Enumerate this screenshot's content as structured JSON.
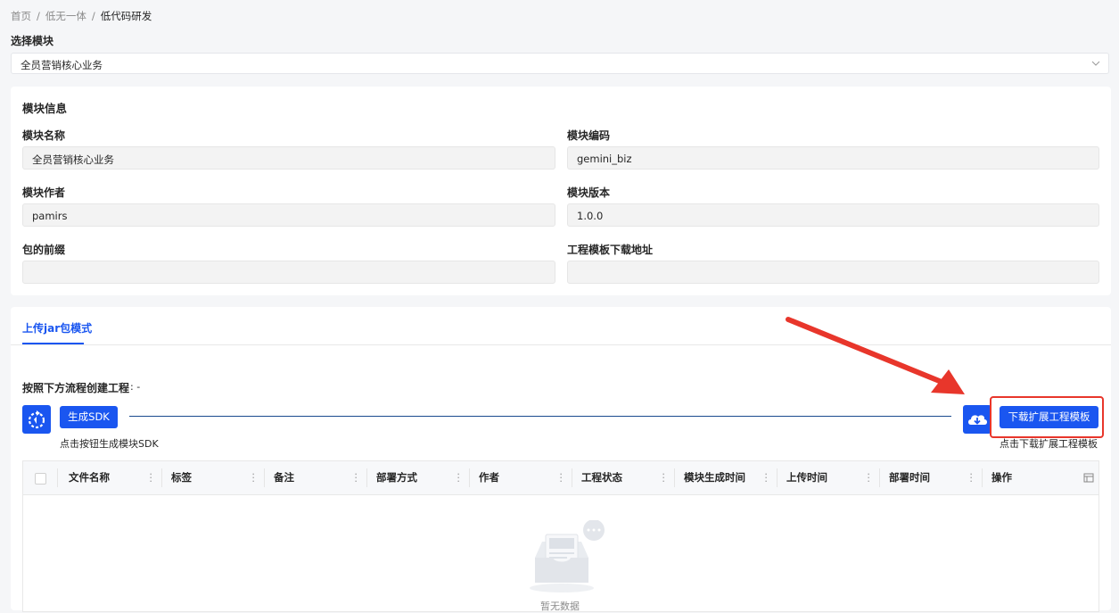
{
  "breadcrumb": {
    "home": "首页",
    "parent": "低无一体",
    "current": "低代码研发",
    "sep": "/"
  },
  "module_select": {
    "label": "选择模块",
    "value": "全员营销核心业务"
  },
  "module_info": {
    "title": "模块信息",
    "name_label": "模块名称",
    "name_value": "全员营销核心业务",
    "code_label": "模块编码",
    "code_value": "gemini_biz",
    "author_label": "模块作者",
    "author_value": "pamirs",
    "version_label": "模块版本",
    "version_value": "1.0.0",
    "prefix_label": "包的前缀",
    "prefix_value": "",
    "template_url_label": "工程模板下载地址",
    "template_url_value": ""
  },
  "tabs": [
    {
      "label": "上传jar包模式",
      "active": true
    }
  ],
  "flow": {
    "title": "按照下方流程创建工程",
    "title_suffix": ": -",
    "generate_button": "生成SDK",
    "generate_hint": "点击按钮生成模块SDK",
    "download_button": "下载扩展工程模板",
    "download_hint": "点击下载扩展工程模板"
  },
  "table": {
    "columns": [
      "文件名称",
      "标签",
      "备注",
      "部署方式",
      "作者",
      "工程状态",
      "模块生成时间",
      "上传时间",
      "部署时间",
      "操作"
    ],
    "rows": [],
    "empty_text": "暂无数据"
  },
  "colors": {
    "primary": "#1a56f0",
    "annotation": "#e8362b"
  }
}
